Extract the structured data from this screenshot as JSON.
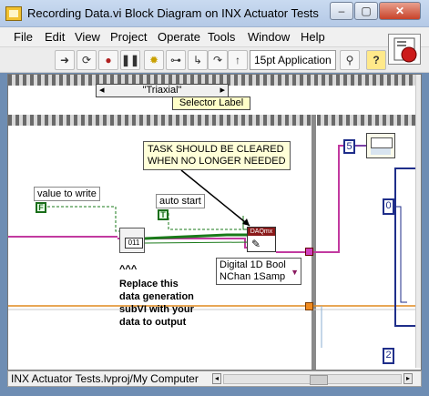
{
  "window": {
    "title": "Recording Data.vi Block Diagram on INX Actuator Tests.lvproj/My Computer",
    "minimize": "–",
    "maximize": "▢",
    "close": "✕"
  },
  "menu": [
    "File",
    "Edit",
    "View",
    "Project",
    "Operate",
    "Tools",
    "Window",
    "Help"
  ],
  "toolbar": {
    "font": "15pt Application"
  },
  "diagram": {
    "case_selector": "\"Triaxial\"",
    "selector_label": "Selector Label",
    "todo_note": [
      "TASK SHOULD BE CLEARED",
      "WHEN NO LONGER NEEDED"
    ],
    "value_to_write": "value to write",
    "value_const": "F",
    "auto_start": "auto start",
    "auto_start_const": "T",
    "caret": "^^^",
    "replace_comment": [
      "Replace this",
      "data generation",
      "subVI with your",
      "data to output"
    ],
    "subvi_label": "011",
    "daq_label": "DAQmx",
    "poly_line1": "Digital 1D Bool",
    "poly_line2": "NChan 1Samp",
    "const_five": "5",
    "const_zero": "0",
    "const_two": "2"
  },
  "status": {
    "path": "INX Actuator Tests.lvproj/My Computer"
  }
}
